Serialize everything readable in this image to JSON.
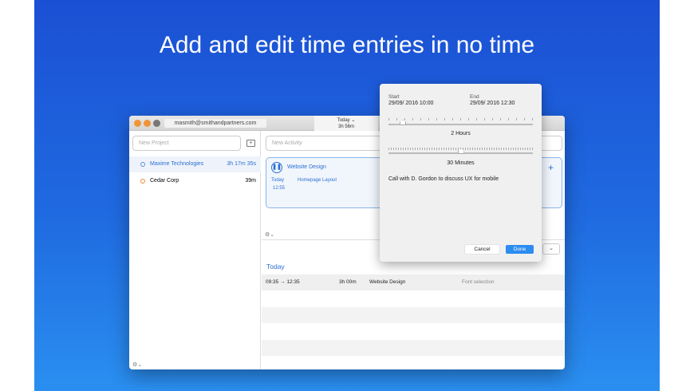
{
  "headline": "Add and edit time entries in no time",
  "window": {
    "account": "masmith@smithandpartners.com",
    "today_label": "Today ⌄",
    "today_total": "3h 56m",
    "new_project_placeholder": "New Project",
    "new_activity_placeholder": "New Activity",
    "projects": [
      {
        "name": "Maxime Technologies",
        "time": "3h 17m 35s",
        "color": "#5b8fd6"
      },
      {
        "name": "Cedar Corp",
        "time": "39m",
        "color": "#e98b3a"
      }
    ],
    "active": {
      "title": "Website Design",
      "day": "Today",
      "time": "12:55",
      "task": "Homepage Layout"
    },
    "section_title": "Today",
    "entries": [
      {
        "range": "09:35 → 12:35",
        "duration": "3h 00m",
        "project": "Website Design",
        "note": "Font selection"
      }
    ]
  },
  "popover": {
    "start_label": "Start",
    "start_value": "29/09/ 2016  10:00",
    "end_label": "End",
    "end_value": "29/09/ 2016  12:30",
    "hours_label": "2 Hours",
    "minutes_label": "30 Minutes",
    "hours_fraction": 0.1,
    "minutes_fraction": 0.5,
    "note": "Call with D. Gordon to discuss UX for mobile",
    "cancel": "Cancel",
    "done": "Done"
  }
}
